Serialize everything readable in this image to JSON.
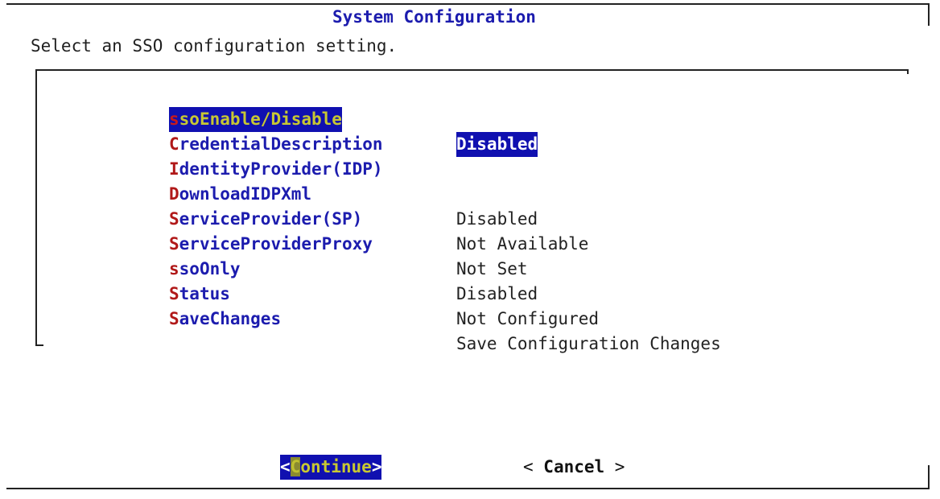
{
  "dialog": {
    "title": "System Configuration",
    "prompt": "Select an SSO configuration setting."
  },
  "menu": {
    "items": [
      {
        "hotkey": "s",
        "rest": "soEnable/Disable",
        "value": "Disabled",
        "selected": true
      },
      {
        "hotkey": "C",
        "rest": "redentialDescription",
        "value": ""
      },
      {
        "hotkey": "I",
        "rest": "dentityProvider(IDP)",
        "value": ""
      },
      {
        "hotkey": "D",
        "rest": "ownloadIDPXml",
        "value": "Disabled"
      },
      {
        "hotkey": "S",
        "rest": "erviceProvider(SP)",
        "value": "Not Available"
      },
      {
        "hotkey": "S",
        "rest": "erviceProviderProxy",
        "value": "Not Set"
      },
      {
        "hotkey": "s",
        "rest": "soOnly",
        "value": "Disabled"
      },
      {
        "hotkey": "S",
        "rest": "tatus",
        "value": "Not Configured"
      },
      {
        "hotkey": "S",
        "rest": "aveChanges",
        "value": "Save Configuration Changes"
      }
    ]
  },
  "buttons": {
    "continue": {
      "open": "<",
      "hotkey": "C",
      "rest": "ontinue",
      "close": ">"
    },
    "cancel": {
      "open": "< ",
      "label": "Cancel",
      "close": " >"
    }
  },
  "colors": {
    "tag_text": "#1c1cae",
    "hotkey": "#b01818",
    "selection_bg": "#1010b0",
    "selection_fg": "#c8c832"
  }
}
